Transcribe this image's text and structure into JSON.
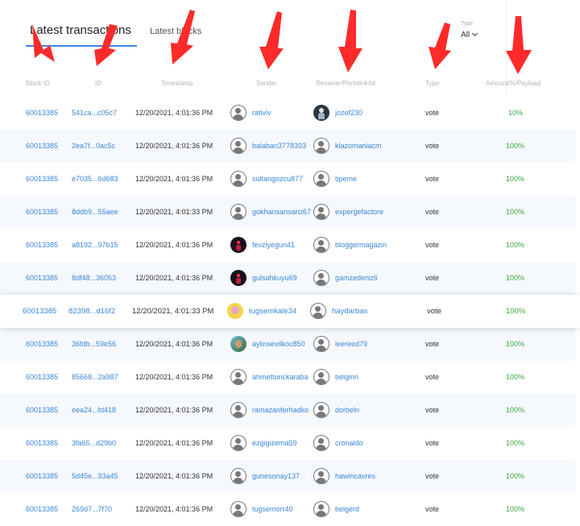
{
  "tabs": {
    "active": "Latest transactions",
    "inactive": "Latest blocks"
  },
  "filter": {
    "label": "Type",
    "value": "All"
  },
  "columns": [
    "Block ID",
    "ID",
    "Timestamp",
    "Sender",
    "Receiver/Permlink/Id",
    "Type",
    "Amount/%/Payload"
  ],
  "rows": [
    {
      "block": "60013385",
      "id": "541ca...c05c7",
      "ts": "12/20/2021, 4:01:36 PM",
      "sender": "rativiv",
      "sender_avatar": "default",
      "receiver": "jozef230",
      "receiver_avatar": "bw",
      "type": "vote",
      "amount": "10%"
    },
    {
      "block": "60013385",
      "id": "2ea7f...0ac5c",
      "ts": "12/20/2021, 4:01:36 PM",
      "sender": "balaban3778393",
      "sender_avatar": "default",
      "receiver": "klazomaniacm",
      "receiver_avatar": "default",
      "type": "vote",
      "amount": "100%"
    },
    {
      "block": "60013385",
      "id": "e7035...6d683",
      "ts": "12/20/2021, 4:01:36 PM",
      "sender": "sultangozcu877",
      "sender_avatar": "default",
      "receiver": "tipeme",
      "receiver_avatar": "default",
      "type": "vote",
      "amount": "100%"
    },
    {
      "block": "60013385",
      "id": "8ddb9...55aee",
      "ts": "12/20/2021, 4:01:33 PM",
      "sender": "gokhansansarci67",
      "sender_avatar": "default",
      "receiver": "expergefactore",
      "receiver_avatar": "default",
      "type": "vote",
      "amount": "100%"
    },
    {
      "block": "60013385",
      "id": "a8192...97b15",
      "ts": "12/20/2021, 4:01:36 PM",
      "sender": "fevziyegun41",
      "sender_avatar": "dark",
      "receiver": "bloggermagazin",
      "receiver_avatar": "default",
      "type": "vote",
      "amount": "100%"
    },
    {
      "block": "60013385",
      "id": "8df48...36053",
      "ts": "12/20/2021, 4:01:36 PM",
      "sender": "gulsahkuyu69",
      "sender_avatar": "dark",
      "receiver": "gamzedenizli",
      "receiver_avatar": "default",
      "type": "vote",
      "amount": "100%"
    },
    {
      "block": "60013385",
      "id": "82398...d16f2",
      "ts": "12/20/2021, 4:01:33 PM",
      "sender": "tugsemkale34",
      "sender_avatar": "yellow",
      "receiver": "haydarbas",
      "receiver_avatar": "default",
      "type": "vote",
      "amount": "100%"
    },
    {
      "block": "60013385",
      "id": "36fdb...59e56",
      "ts": "12/20/2021, 4:01:36 PM",
      "sender": "aylinsevilkoc850",
      "sender_avatar": "photo",
      "receiver": "leereed79",
      "receiver_avatar": "default",
      "type": "vote",
      "amount": "100%"
    },
    {
      "block": "60013385",
      "id": "85668...2a987",
      "ts": "12/20/2021, 4:01:36 PM",
      "sender": "ahmettunckaraba",
      "sender_avatar": "default",
      "receiver": "belginn",
      "receiver_avatar": "default",
      "type": "vote",
      "amount": "100%"
    },
    {
      "block": "60013385",
      "id": "eea24...fd418",
      "ts": "12/20/2021, 4:01:36 PM",
      "sender": "ramazanferhadko",
      "sender_avatar": "default",
      "receiver": "dorbeln",
      "receiver_avatar": "default",
      "type": "vote",
      "amount": "100%"
    },
    {
      "block": "60013385",
      "id": "3fa65...d29b0",
      "ts": "12/20/2021, 4:01:36 PM",
      "sender": "ezgigizema59",
      "sender_avatar": "default",
      "receiver": "cronaldo",
      "receiver_avatar": "default",
      "type": "vote",
      "amount": "100%"
    },
    {
      "block": "60013385",
      "id": "5d45e...93a45",
      "ts": "12/20/2021, 4:01:36 PM",
      "sender": "gunesonay137",
      "sender_avatar": "default",
      "receiver": "hawincavres",
      "receiver_avatar": "default",
      "type": "vote",
      "amount": "100%"
    },
    {
      "block": "60013385",
      "id": "269d7...7f70",
      "ts": "12/20/2021, 4:01:36 PM",
      "sender": "tugsemorr40",
      "sender_avatar": "default",
      "receiver": "belgerd",
      "receiver_avatar": "default",
      "type": "vote",
      "amount": "100%"
    }
  ],
  "colors": {
    "accent": "#3b87e0",
    "link": "#3a87d9",
    "success": "#39a83a",
    "annotation": "#ff2a2a",
    "row_alt": "#f5f8fc"
  }
}
